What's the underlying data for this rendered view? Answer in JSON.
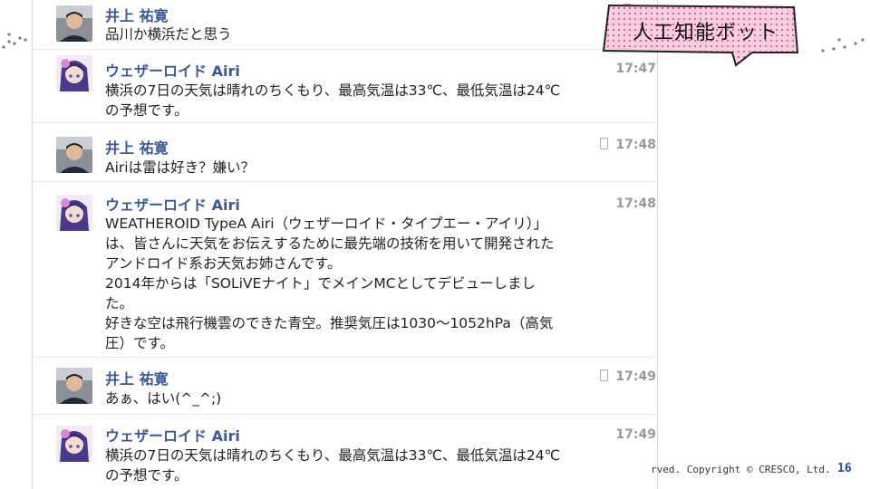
{
  "callout": {
    "text": "人工知能ボット"
  },
  "messages": [
    {
      "name": "井上 祐寛",
      "time": "17",
      "lines": [
        "品川か横浜だと思う"
      ]
    },
    {
      "name": "ウェザーロイド Airi",
      "time": "17:47",
      "lines": [
        "横浜の7日の天気は晴れのちくもり、最高気温は33℃、最低気温は24℃",
        "の予想です。"
      ]
    },
    {
      "name": "井上 祐寛",
      "time": "17:48",
      "lines": [
        "Airiは雷は好き？嫌い？"
      ]
    },
    {
      "name": "ウェザーロイド Airi",
      "time": "17:48",
      "lines": [
        "WEATHEROID TypeA Airi（ウェザーロイド・タイプエー・アイリ）」",
        "は、皆さんに天気をお伝えするために最先端の技術を用いて開発された",
        "アンドロイド系お天気お姉さんです。",
        "2014年からは「SOLiVEナイト」でメインMCとしてデビューしまし",
        "た。",
        "好きな空は飛行機雲のできた青空。推奨気圧は1030～1052hPa（高気",
        "圧）です。"
      ]
    },
    {
      "name": "井上 祐寛",
      "time": "17:49",
      "lines": [
        "あぁ、はい(^_^;)"
      ]
    },
    {
      "name": "ウェザーロイド Airi",
      "time": "17:49",
      "lines": [
        "横浜の7日の天気は晴れのちくもり、最高気温は33℃、最低気温は24℃",
        "の予想です。"
      ]
    }
  ],
  "footer": {
    "copyright": "rved. Copyright © CRESCO, Ltd.",
    "page": "16"
  },
  "colors": {
    "name": "#3b5998",
    "callout_fill": "#f7cfe0",
    "callout_dots": "#e23a7a"
  }
}
